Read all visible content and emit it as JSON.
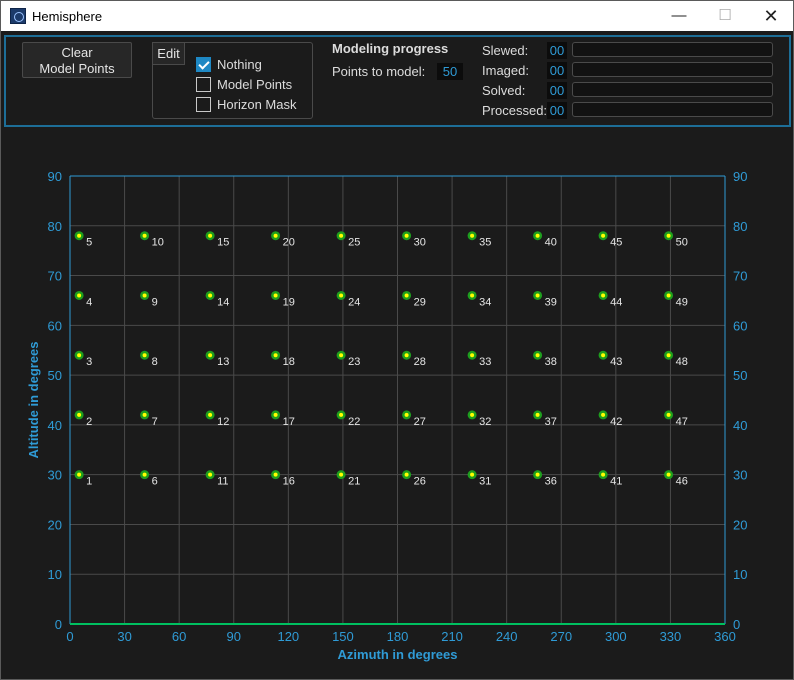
{
  "window": {
    "title": "Hemisphere",
    "min_symbol": "—",
    "max_symbol": "☐",
    "close_symbol": "✕"
  },
  "toolbar": {
    "clear_button": "Clear\nModel Points",
    "edit_button": "Edit",
    "options": [
      {
        "label": "Nothing",
        "checked": true
      },
      {
        "label": "Model Points",
        "checked": false
      },
      {
        "label": "Horizon Mask",
        "checked": false
      }
    ],
    "modeling_progress_title": "Modeling progress",
    "points_to_model_label": "Points to model:",
    "points_to_model_value": "50",
    "progress": [
      {
        "label": "Slewed:",
        "value": "00",
        "fraction": 0
      },
      {
        "label": "Imaged:",
        "value": "00",
        "fraction": 0
      },
      {
        "label": "Solved:",
        "value": "00",
        "fraction": 0
      },
      {
        "label": "Processed:",
        "value": "00",
        "fraction": 0
      }
    ]
  },
  "colors": {
    "background": "#1b1b1b",
    "accent": "#2f9bd6",
    "grid": "#4a4a4a",
    "point_ring": "#1e9e1e",
    "point_center": "#ffff00",
    "horizon": "#00c060"
  },
  "chart_data": {
    "type": "scatter",
    "xlabel": "Azimuth in degrees",
    "ylabel": "Altitude in degrees",
    "xlim": [
      0,
      360
    ],
    "ylim": [
      0,
      90
    ],
    "xticks": [
      0,
      30,
      60,
      90,
      120,
      150,
      180,
      210,
      240,
      270,
      300,
      330,
      360
    ],
    "yticks": [
      0,
      10,
      20,
      30,
      40,
      50,
      60,
      70,
      80,
      90
    ],
    "grid": true,
    "points": [
      {
        "label": "1",
        "az": 5,
        "alt": 30
      },
      {
        "label": "2",
        "az": 5,
        "alt": 42
      },
      {
        "label": "3",
        "az": 5,
        "alt": 54
      },
      {
        "label": "4",
        "az": 5,
        "alt": 66
      },
      {
        "label": "5",
        "az": 5,
        "alt": 78
      },
      {
        "label": "6",
        "az": 41,
        "alt": 30
      },
      {
        "label": "7",
        "az": 41,
        "alt": 42
      },
      {
        "label": "8",
        "az": 41,
        "alt": 54
      },
      {
        "label": "9",
        "az": 41,
        "alt": 66
      },
      {
        "label": "10",
        "az": 41,
        "alt": 78
      },
      {
        "label": "11",
        "az": 77,
        "alt": 30
      },
      {
        "label": "12",
        "az": 77,
        "alt": 42
      },
      {
        "label": "13",
        "az": 77,
        "alt": 54
      },
      {
        "label": "14",
        "az": 77,
        "alt": 66
      },
      {
        "label": "15",
        "az": 77,
        "alt": 78
      },
      {
        "label": "16",
        "az": 113,
        "alt": 30
      },
      {
        "label": "17",
        "az": 113,
        "alt": 42
      },
      {
        "label": "18",
        "az": 113,
        "alt": 54
      },
      {
        "label": "19",
        "az": 113,
        "alt": 66
      },
      {
        "label": "20",
        "az": 113,
        "alt": 78
      },
      {
        "label": "21",
        "az": 149,
        "alt": 30
      },
      {
        "label": "22",
        "az": 149,
        "alt": 42
      },
      {
        "label": "23",
        "az": 149,
        "alt": 54
      },
      {
        "label": "24",
        "az": 149,
        "alt": 66
      },
      {
        "label": "25",
        "az": 149,
        "alt": 78
      },
      {
        "label": "26",
        "az": 185,
        "alt": 30
      },
      {
        "label": "27",
        "az": 185,
        "alt": 42
      },
      {
        "label": "28",
        "az": 185,
        "alt": 54
      },
      {
        "label": "29",
        "az": 185,
        "alt": 66
      },
      {
        "label": "30",
        "az": 185,
        "alt": 78
      },
      {
        "label": "31",
        "az": 221,
        "alt": 30
      },
      {
        "label": "32",
        "az": 221,
        "alt": 42
      },
      {
        "label": "33",
        "az": 221,
        "alt": 54
      },
      {
        "label": "34",
        "az": 221,
        "alt": 66
      },
      {
        "label": "35",
        "az": 221,
        "alt": 78
      },
      {
        "label": "36",
        "az": 257,
        "alt": 30
      },
      {
        "label": "37",
        "az": 257,
        "alt": 42
      },
      {
        "label": "38",
        "az": 257,
        "alt": 54
      },
      {
        "label": "39",
        "az": 257,
        "alt": 66
      },
      {
        "label": "40",
        "az": 257,
        "alt": 78
      },
      {
        "label": "41",
        "az": 293,
        "alt": 30
      },
      {
        "label": "42",
        "az": 293,
        "alt": 42
      },
      {
        "label": "43",
        "az": 293,
        "alt": 54
      },
      {
        "label": "44",
        "az": 293,
        "alt": 66
      },
      {
        "label": "45",
        "az": 293,
        "alt": 78
      },
      {
        "label": "46",
        "az": 329,
        "alt": 30
      },
      {
        "label": "47",
        "az": 329,
        "alt": 42
      },
      {
        "label": "48",
        "az": 329,
        "alt": 54
      },
      {
        "label": "49",
        "az": 329,
        "alt": 66
      },
      {
        "label": "50",
        "az": 329,
        "alt": 78
      }
    ]
  }
}
